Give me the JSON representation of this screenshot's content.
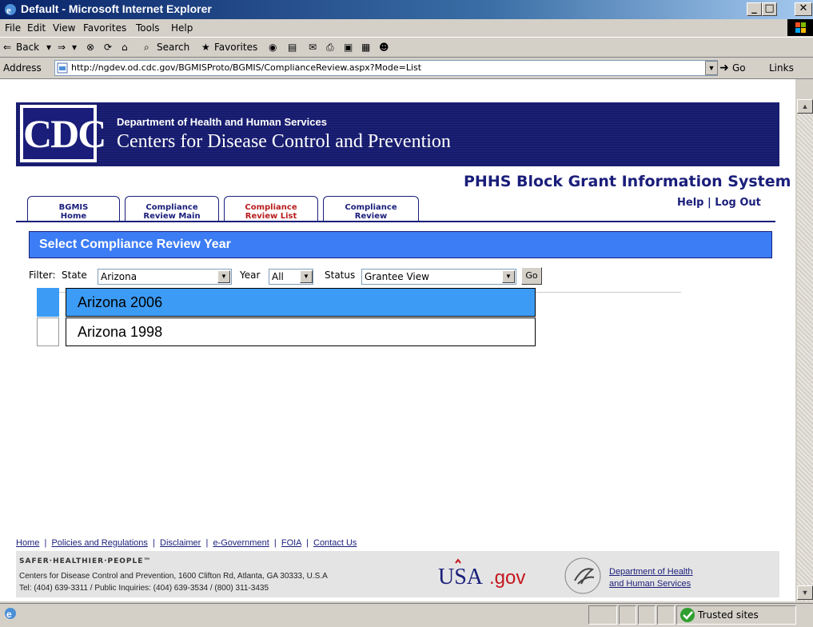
{
  "window": {
    "title": "Default - Microsoft Internet Explorer"
  },
  "menu": {
    "items": [
      "File",
      "Edit",
      "View",
      "Favorites",
      "Tools",
      "Help"
    ]
  },
  "toolbar": {
    "back": "Back",
    "search": "Search",
    "favorites": "Favorites"
  },
  "address_bar": {
    "label": "Address",
    "url": "http://ngdev.od.cdc.gov/BGMISProto/BGMIS/ComplianceReview.aspx?Mode=List",
    "go": "Go",
    "links": "Links"
  },
  "header": {
    "logo_text": "CDC",
    "department": "Department of Health and Human Services",
    "agency": "Centers for Disease Control and Prevention",
    "system_title": "PHHS Block Grant Information System",
    "help": "Help",
    "logout": "Log Out"
  },
  "tabs": [
    {
      "line1": "BGMIS",
      "line2": "Home"
    },
    {
      "line1": "Compliance",
      "line2": "Review Main"
    },
    {
      "line1": "Compliance",
      "line2": "Review List"
    },
    {
      "line1": "Compliance",
      "line2": "Review"
    }
  ],
  "section": {
    "title": "Select Compliance Review Year"
  },
  "filter": {
    "label": "Filter:",
    "state_label": "State",
    "state_value": "Arizona",
    "year_label": "Year",
    "year_value": "All",
    "status_label": "Status",
    "status_value": "Grantee View",
    "go": "Go"
  },
  "reviews": [
    {
      "label": "Arizona 2006",
      "selected": true
    },
    {
      "label": "Arizona 1998",
      "selected": false
    }
  ],
  "footer": {
    "links": [
      "Home",
      "Policies and Regulations",
      "Disclaimer",
      "e-Government",
      "FOIA",
      "Contact Us"
    ],
    "tagline": "SAFER·HEALTHIER·PEOPLE™",
    "address_line1": "Centers for Disease Control and Prevention, 1600 Clifton Rd, Atlanta, GA 30333, U.S.A",
    "address_line2": "Tel: (404) 639-3311 / Public Inquiries: (404) 639-3534 / (800) 311-3435",
    "usagov": "USA.gov",
    "hhs_line1": "Department of Health",
    "hhs_line2": "and Human Services"
  },
  "status_bar": {
    "zone": "Trusted sites"
  },
  "colors": {
    "cdc_blue": "#1a1e7a",
    "section_blue": "#3c7cf4",
    "selected_row": "#3c9bf4",
    "active_tab_text": "#b81d1d"
  }
}
